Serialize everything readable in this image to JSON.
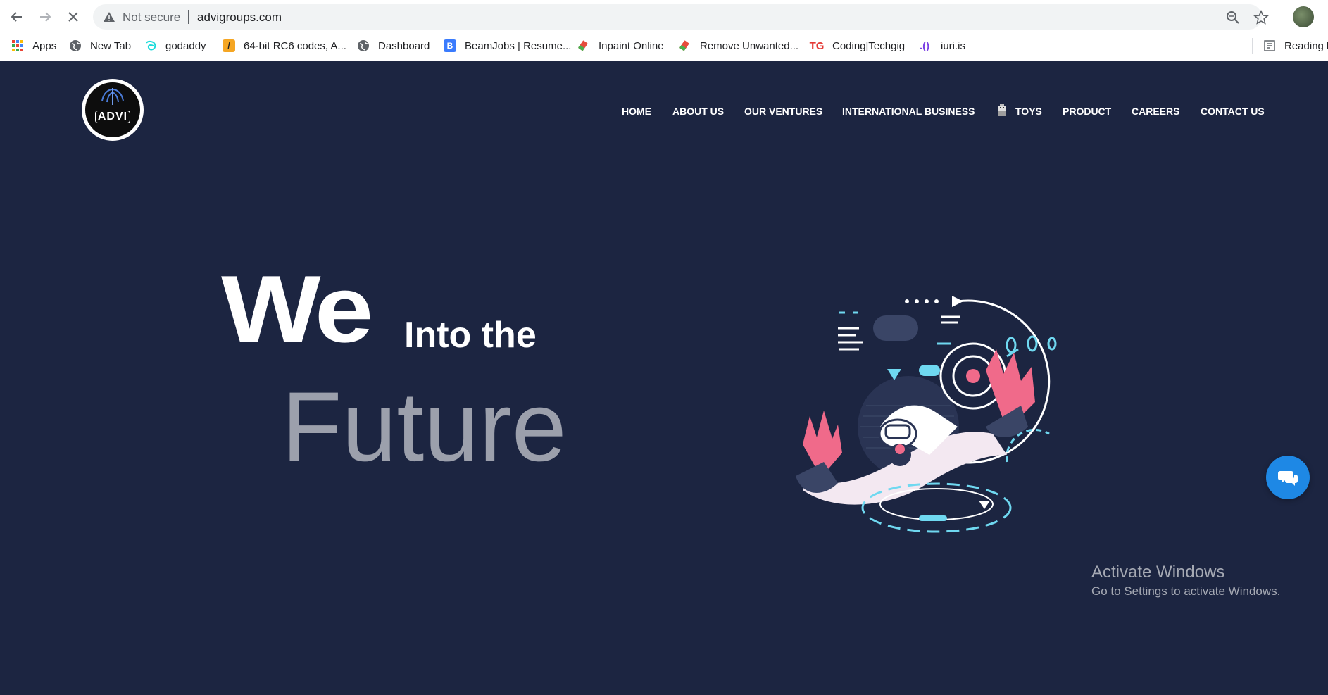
{
  "browser": {
    "back_icon": "arrow-left-icon",
    "forward_icon": "arrow-right-icon",
    "stop_icon": "close-icon",
    "security_label": "Not secure",
    "url": "advigroups.com",
    "zoom_icon": "zoom-icon",
    "star_icon": "star-icon",
    "bookmarks": [
      {
        "label": "Apps",
        "icon": "apps-grid-icon"
      },
      {
        "label": "New Tab",
        "icon": "globe-icon"
      },
      {
        "label": "godaddy",
        "icon": "godaddy-icon"
      },
      {
        "label": "64-bit RC6 codes, A...",
        "icon": "bookmark-favicon-icon"
      },
      {
        "label": "Dashboard",
        "icon": "globe-icon"
      },
      {
        "label": "BeamJobs | Resume...",
        "icon": "beamjobs-icon"
      },
      {
        "label": "Inpaint Online",
        "icon": "eraser-icon"
      },
      {
        "label": "Remove Unwanted...",
        "icon": "eraser-icon"
      },
      {
        "label": "Coding|Techgig",
        "icon": "techgig-icon"
      },
      {
        "label": "iuri.is",
        "icon": "iuri-icon"
      }
    ],
    "reading_list": "Reading li"
  },
  "site": {
    "logo_text": "ADVI",
    "nav": [
      {
        "label": "HOME"
      },
      {
        "label": "ABOUT US"
      },
      {
        "label": "OUR VENTURES"
      },
      {
        "label": "INTERNATIONAL BUSINESS"
      },
      {
        "label": "TOYS",
        "icon": "toy-robot-icon"
      },
      {
        "label": "PRODUCT"
      },
      {
        "label": "CAREERS"
      },
      {
        "label": "CONTACT US"
      }
    ],
    "hero": {
      "word1": "We",
      "word2": "Into the",
      "word3": "Future"
    },
    "chat_icon": "chat-bubbles-icon"
  },
  "os_watermark": {
    "title": "Activate Windows",
    "subtitle": "Go to Settings to activate Windows."
  },
  "colors": {
    "site_background": "#1c2541",
    "future_text": "#9ca0ac",
    "chat_button": "#1e88e5",
    "illustration_pink": "#f06a8a",
    "illustration_cyan": "#6fd8f0"
  }
}
